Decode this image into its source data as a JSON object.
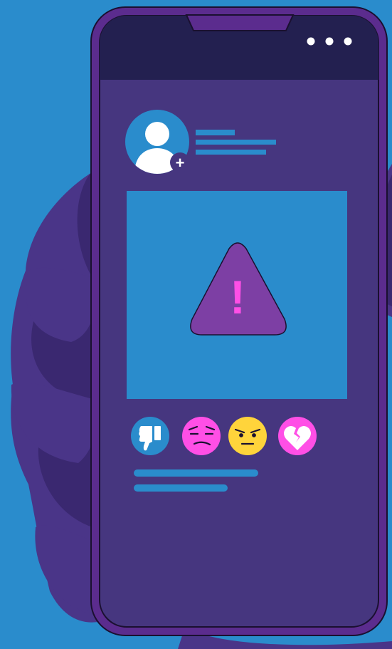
{
  "colors": {
    "background": "#2a8ccc",
    "hand": "#4a3588",
    "hand_shadow": "#3a2870",
    "phone_frame": "#5b2c8e",
    "screen": "#46367f",
    "status_bar": "#232050",
    "accent_blue": "#2a8ccc",
    "warning_triangle": "#7d3fa4",
    "exclamation": "#ff4fe6",
    "reaction_pink": "#ff4fe6",
    "reaction_yellow": "#ffd43b"
  },
  "icons": {
    "menu": "more-dots-icon",
    "profile": "user-avatar-icon",
    "add": "plus-icon",
    "warning": "warning-triangle-icon",
    "dislike": "thumbs-down-icon",
    "sad": "unamused-face-icon",
    "angry": "angry-face-icon",
    "heartbreak": "broken-heart-icon"
  },
  "warning": {
    "symbol": "!"
  },
  "profile": {
    "add_symbol": "+"
  }
}
